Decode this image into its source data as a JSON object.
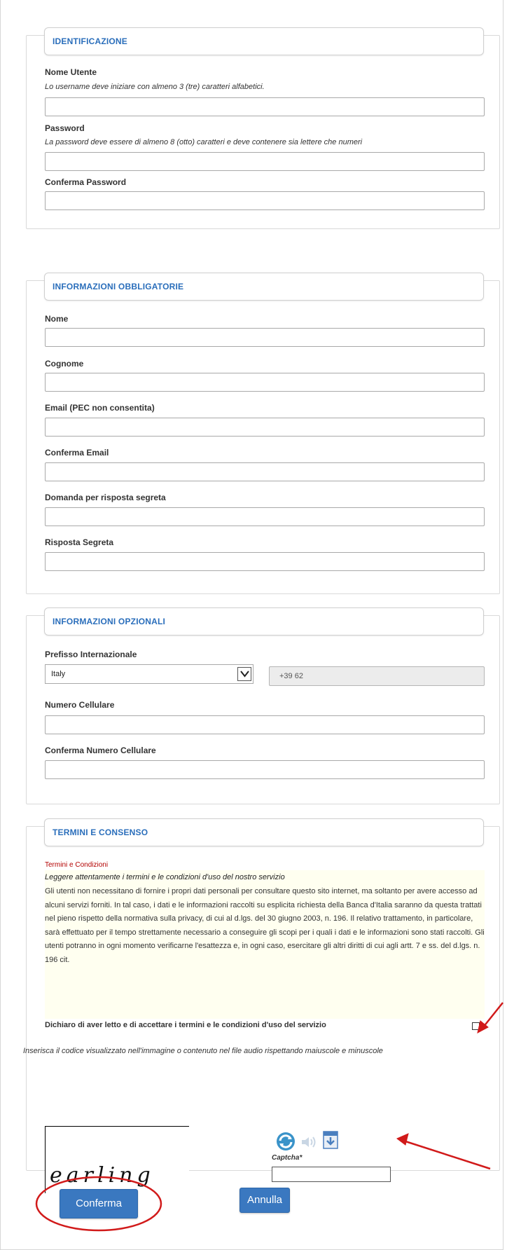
{
  "sections": {
    "identificazione": {
      "legend": "IDENTIFICAZIONE",
      "username_label": "Nome Utente",
      "username_hint": "Lo username deve iniziare con almeno 3 (tre) caratteri alfabetici.",
      "password_label": "Password",
      "password_hint": "La password deve essere di almeno 8 (otto) caratteri e deve contenere sia lettere che numeri",
      "confirm_password_label": "Conferma Password"
    },
    "obbligatorie": {
      "legend": "INFORMAZIONI OBBLIGATORIE",
      "nome_label": "Nome",
      "cognome_label": "Cognome",
      "email_label": "Email (PEC non consentita)",
      "confirm_email_label": "Conferma Email",
      "domanda_label": "Domanda per risposta segreta",
      "risposta_label": "Risposta Segreta"
    },
    "opzionali": {
      "legend": "INFORMAZIONI OPZIONALI",
      "prefisso_label": "Prefisso Internazionale",
      "country_selected": "Italy",
      "prefix_value": "+39 62",
      "cellulare_label": "Numero Cellulare",
      "confirm_cellulare_label": "Conferma Numero Cellulare"
    },
    "termini": {
      "legend": "TERMINI E CONSENSO",
      "terms_title": "Termini e Condizioni",
      "terms_lead": "Leggere attentamente i termini e le condizioni d'uso del nostro servizio",
      "terms_body": "Gli utenti non necessitano di fornire i propri dati personali per consultare questo sito internet, ma soltanto per avere accesso ad alcuni servizi forniti. In tal caso, i dati e le informazioni raccolti su esplicita richiesta della Banca d'Italia saranno da questa trattati nel pieno rispetto della normativa sulla privacy, di cui al d.lgs. del 30 giugno 2003, n. 196. Il relativo trattamento, in particolare, sarà effettuato per il tempo strettamente necessario a conseguire gli scopi per i quali i dati e le informazioni sono stati raccolti. Gli utenti potranno in ogni momento verificarne l'esattezza e, in ogni caso, esercitare gli altri diritti di cui agli artt. 7 e ss. del d.lgs. n. 196 cit.",
      "accept_label": "Dichiaro di aver letto e di accettare i termini e le condizioni d'uso del servizio",
      "captcha_instructions": "Inserisca il codice visualizzato nell'immagine o contenuto nel file audio rispettando maiuscole e minuscole",
      "captcha_text": "earling",
      "captcha_label": "Captcha*"
    }
  },
  "buttons": {
    "confirm": "Conferma",
    "cancel": "Annulla"
  },
  "colors": {
    "accent": "#2a6ebb",
    "button": "#3a78c0",
    "annotation": "#d11a1a"
  },
  "icons": [
    "refresh-icon",
    "audio-icon",
    "download-icon",
    "chevron-down-icon"
  ]
}
